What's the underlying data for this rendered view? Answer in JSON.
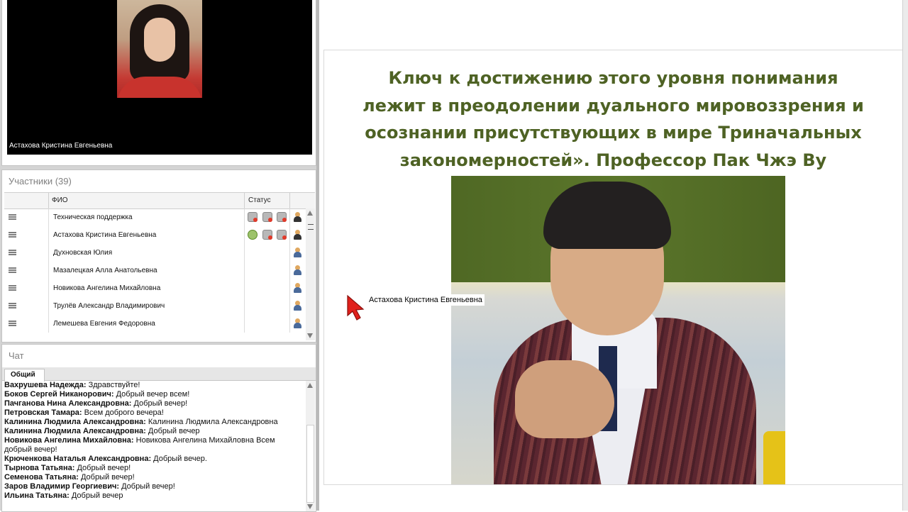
{
  "video": {
    "speaker_name": "Астахова Кристина Евгеньевна"
  },
  "participants": {
    "title": "Участники (39)",
    "col_name": "ФИО",
    "col_status": "Статус",
    "rows": [
      {
        "name": "Техническая поддержка",
        "icons": [
          "cam-off",
          "cam-off",
          "screen-off",
          "user-dark"
        ]
      },
      {
        "name": "Астахова Кристина Евгеньевна",
        "icons": [
          "ok",
          "cam-off",
          "screen-off",
          "user-dark"
        ]
      },
      {
        "name": "Духновская Юлия",
        "icons": [
          "user"
        ]
      },
      {
        "name": "Мазалецкая Алла Анатольевна",
        "icons": [
          "user"
        ]
      },
      {
        "name": "Новикова Ангелина Михайловна",
        "icons": [
          "user"
        ]
      },
      {
        "name": "Трулёв Александр Владимирович",
        "icons": [
          "user"
        ]
      },
      {
        "name": "Лемешева Евгения Федоровна",
        "icons": [
          "user"
        ]
      }
    ]
  },
  "chat": {
    "title": "Чат",
    "tab_label": "Общий",
    "messages": [
      {
        "author": "Вахрушева Надежда:",
        "text": " Здравствуйте!"
      },
      {
        "author": "Боков Сергей Никанорович:",
        "text": " Добрый вечер всем!"
      },
      {
        "author": "Пачганова Нина Александровна:",
        "text": " Добрый вечер!"
      },
      {
        "author": "Петровская Тамара:",
        "text": " Всем доброго вечера!"
      },
      {
        "author": "Калинина Людмила  Александровна:",
        "text": " Калинина Людмила Александровна"
      },
      {
        "author": "Калинина Людмила  Александровна:",
        "text": " Добрый вечер"
      },
      {
        "author": "Новикова Ангелина Михайловна:",
        "text": " Новикова Ангелина Михайловна Всем добрый вечер!"
      },
      {
        "author": "Крюченкова Наталья Александровна:",
        "text": " Добрый вечер."
      },
      {
        "author": "Тырнова Татьяна:",
        "text": " Добрый вечер!"
      },
      {
        "author": "Семенова Татьяна:",
        "text": " Добрый вечер!"
      },
      {
        "author": "Заров Владимир Георгиевич:",
        "text": " Добрый вечер!"
      },
      {
        "author": "Ильина Татьяна:",
        "text": " Добрый вечер"
      }
    ]
  },
  "slide": {
    "text_lines": [
      "Ключ к достижению этого уровня понимания",
      "лежит в преодолении дуального мировоззрения и",
      "осознании присутствующих в мире Триначальных",
      "закономерностей». Профессор Пак Чжэ Ву"
    ],
    "text_color": "#4e6224"
  },
  "pointer": {
    "label": "Астахова Кристина Евгеньевна",
    "color": "#e0201c"
  }
}
